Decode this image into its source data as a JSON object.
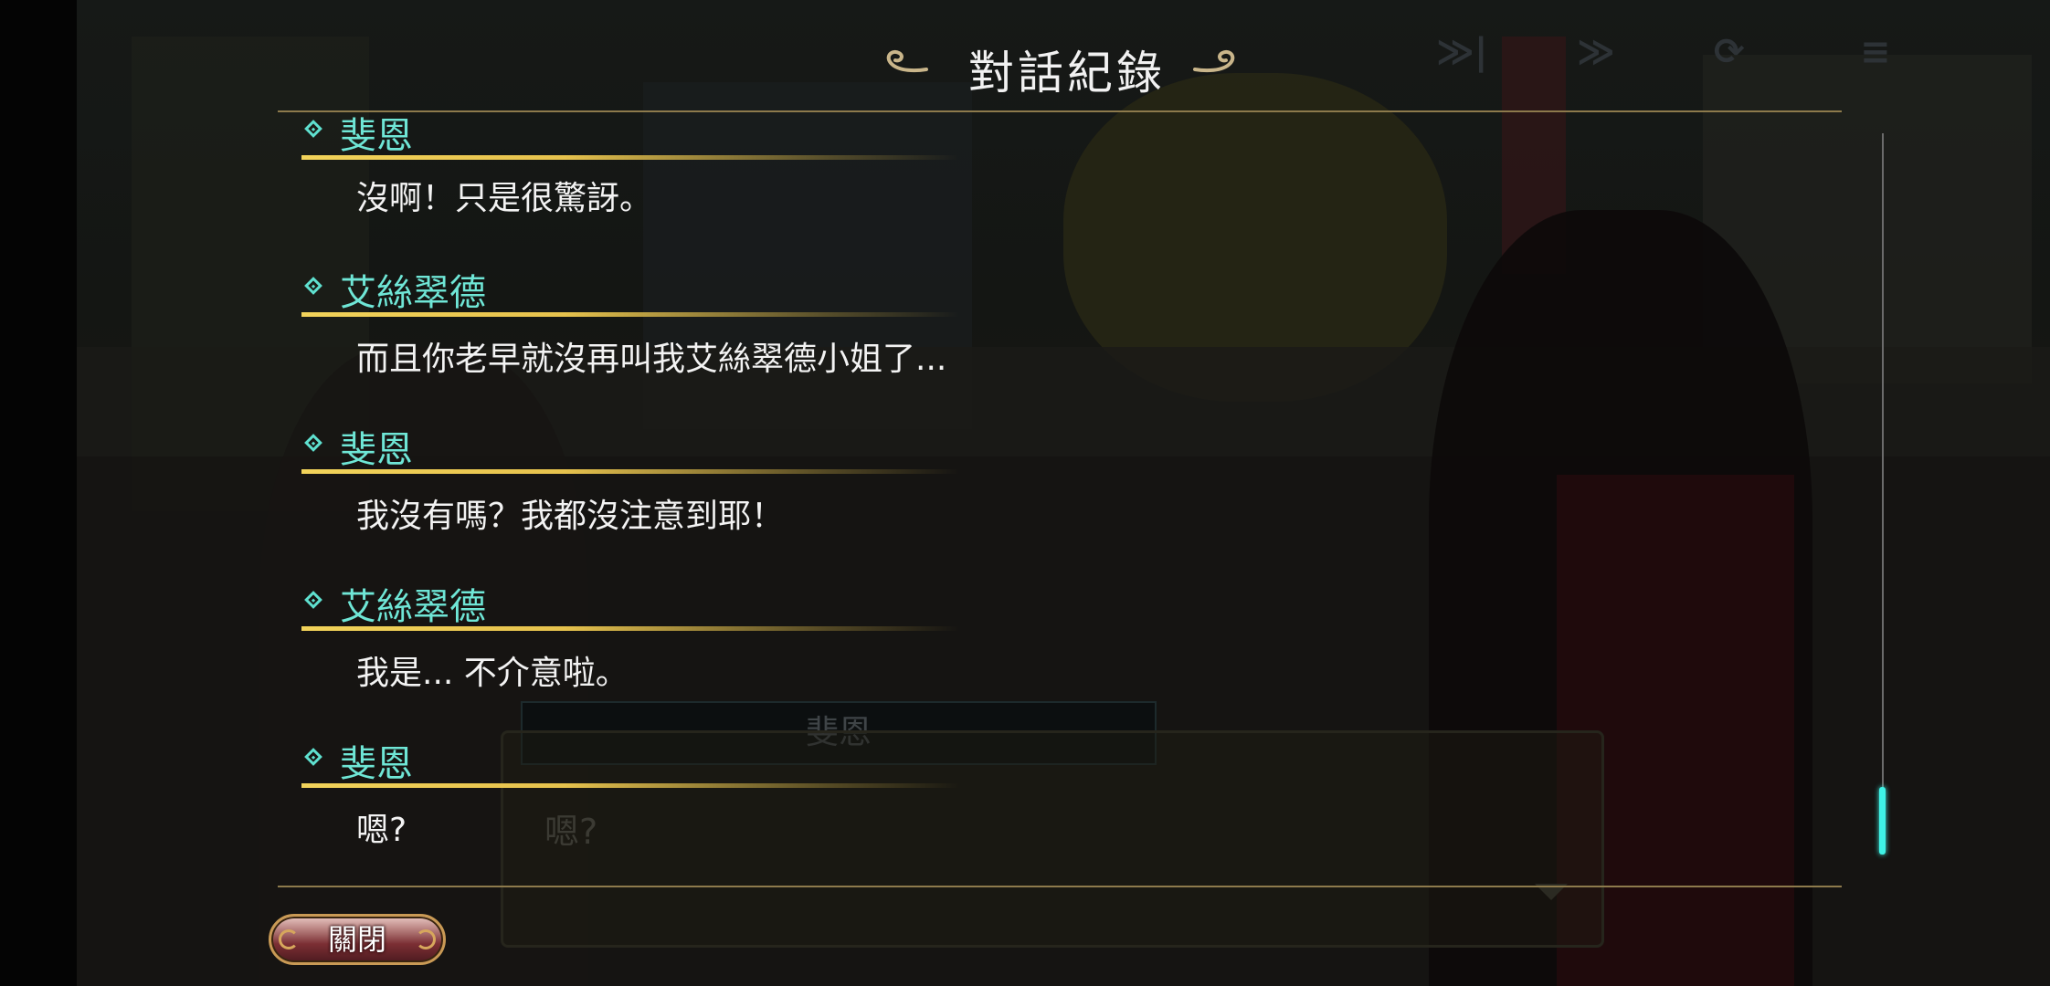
{
  "header": {
    "title": "對話紀錄"
  },
  "log": {
    "entries": [
      {
        "speaker": "斐恩",
        "text": "沒啊！只是很驚訝。"
      },
      {
        "speaker": "艾絲翠德",
        "text": "而且你老早就沒再叫我艾絲翠德小姐了..."
      },
      {
        "speaker": "斐恩",
        "text": "我沒有嗎？我都沒注意到耶！"
      },
      {
        "speaker": "艾絲翠德",
        "text": "我是... 不介意啦。"
      },
      {
        "speaker": "斐恩",
        "text": "嗯?"
      }
    ]
  },
  "background_dialogue": {
    "speaker": "斐恩",
    "text": "嗯?"
  },
  "buttons": {
    "close_label": "關閉"
  },
  "hud": {
    "icons": [
      "fast-forward-icon",
      "skip-icon",
      "auto-icon",
      "log-icon"
    ]
  },
  "colors": {
    "speaker": "#6fe6d6",
    "underline": "#f2d35a",
    "rule": "#8d7a4c",
    "scroll_thumb": "#3ff3e6"
  }
}
